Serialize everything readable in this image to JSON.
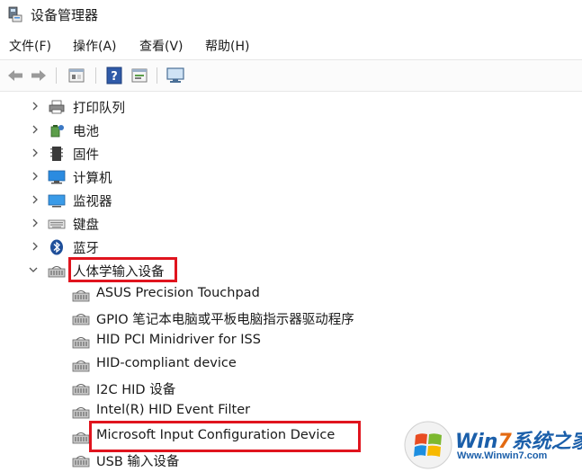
{
  "window": {
    "title": "设备管理器"
  },
  "menu": [
    {
      "label": "文件(F)"
    },
    {
      "label": "操作(A)"
    },
    {
      "label": "查看(V)"
    },
    {
      "label": "帮助(H)"
    }
  ],
  "toolbar": {
    "icons": [
      "back-arrow-icon",
      "forward-arrow-icon",
      "properties-icon",
      "help-icon",
      "update-driver-icon",
      "monitor-icon"
    ]
  },
  "tree": {
    "categories": [
      {
        "label": "打印队列",
        "icon": "printer-icon",
        "expanded": false
      },
      {
        "label": "电池",
        "icon": "battery-icon",
        "expanded": false
      },
      {
        "label": "固件",
        "icon": "firmware-chip-icon",
        "expanded": false
      },
      {
        "label": "计算机",
        "icon": "computer-icon",
        "expanded": false
      },
      {
        "label": "监视器",
        "icon": "monitor-icon",
        "expanded": false
      },
      {
        "label": "键盘",
        "icon": "keyboard-icon",
        "expanded": false
      },
      {
        "label": "蓝牙",
        "icon": "bluetooth-icon",
        "expanded": false
      },
      {
        "label": "人体学输入设备",
        "icon": "hid-device-icon",
        "expanded": true
      }
    ],
    "hid_devices": [
      {
        "label": "ASUS Precision Touchpad"
      },
      {
        "label": "GPIO 笔记本电脑或平板电脑指示器驱动程序"
      },
      {
        "label": "HID PCI Minidriver for ISS"
      },
      {
        "label": "HID-compliant device"
      },
      {
        "label": "I2C HID 设备"
      },
      {
        "label": "Intel(R) HID Event Filter"
      },
      {
        "label": "Microsoft Input Configuration Device"
      },
      {
        "label": "USB 输入设备"
      }
    ]
  },
  "watermark": {
    "brand_part1": "Win",
    "brand_part2": "7",
    "brand_part3": "系统之家",
    "url": "Www.Winwin7.com"
  },
  "colors": {
    "highlight": "#e0141e",
    "brand": "#1b5faa"
  }
}
